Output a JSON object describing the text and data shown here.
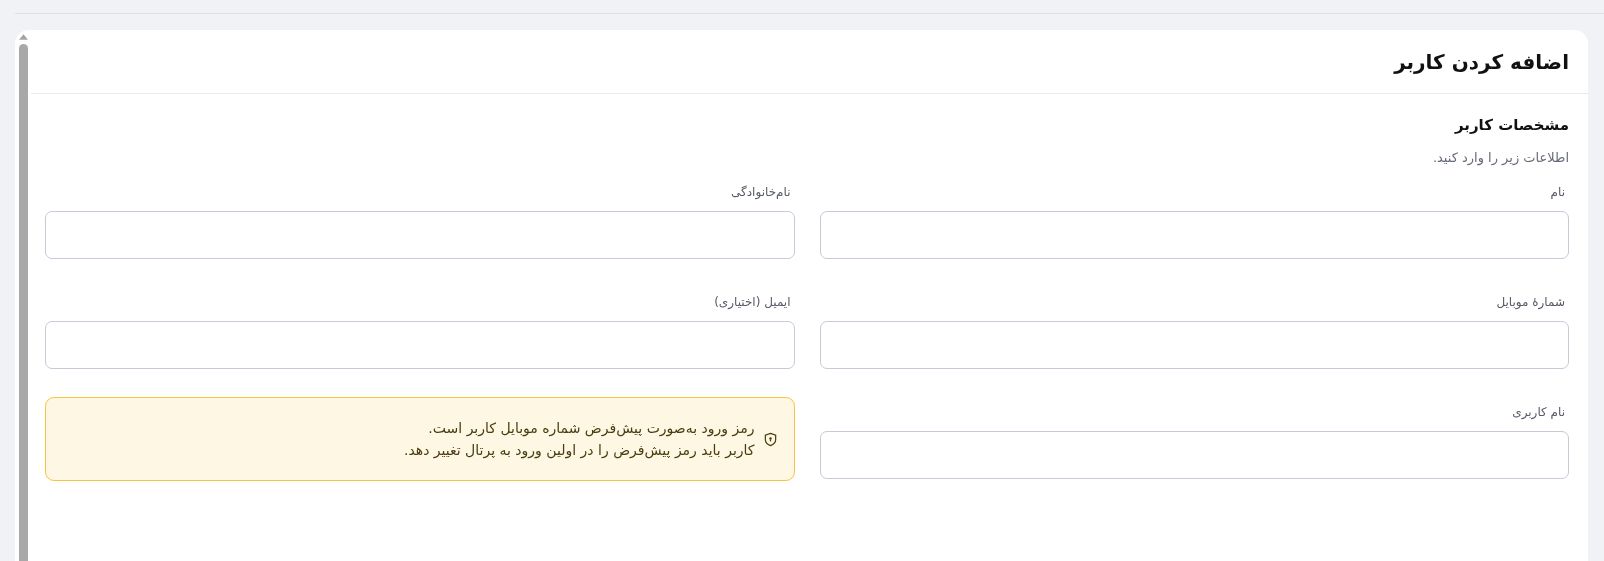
{
  "card": {
    "title": "اضافه کردن کاربر"
  },
  "section": {
    "title": "مشخصات کاربر",
    "subtitle": "اطلاعات زیر را وارد کنید."
  },
  "fields": [
    {
      "kind": "input",
      "label": "نام"
    },
    {
      "kind": "input",
      "label": "نام‌خانوادگی"
    },
    {
      "kind": "input",
      "label": "شمارهٔ موبایل"
    },
    {
      "kind": "input",
      "label": "ایمیل (اختیاری)"
    },
    {
      "kind": "input",
      "label": "نام کاربری"
    },
    {
      "kind": "alert",
      "lines": [
        "رمز ورود به‌صورت پیش‌فرض شماره موبایل کاربر است.",
        "کاربر باید رمز پیش‌فرض را در اولین ورود به پرتال تغییر دهد."
      ]
    }
  ]
}
